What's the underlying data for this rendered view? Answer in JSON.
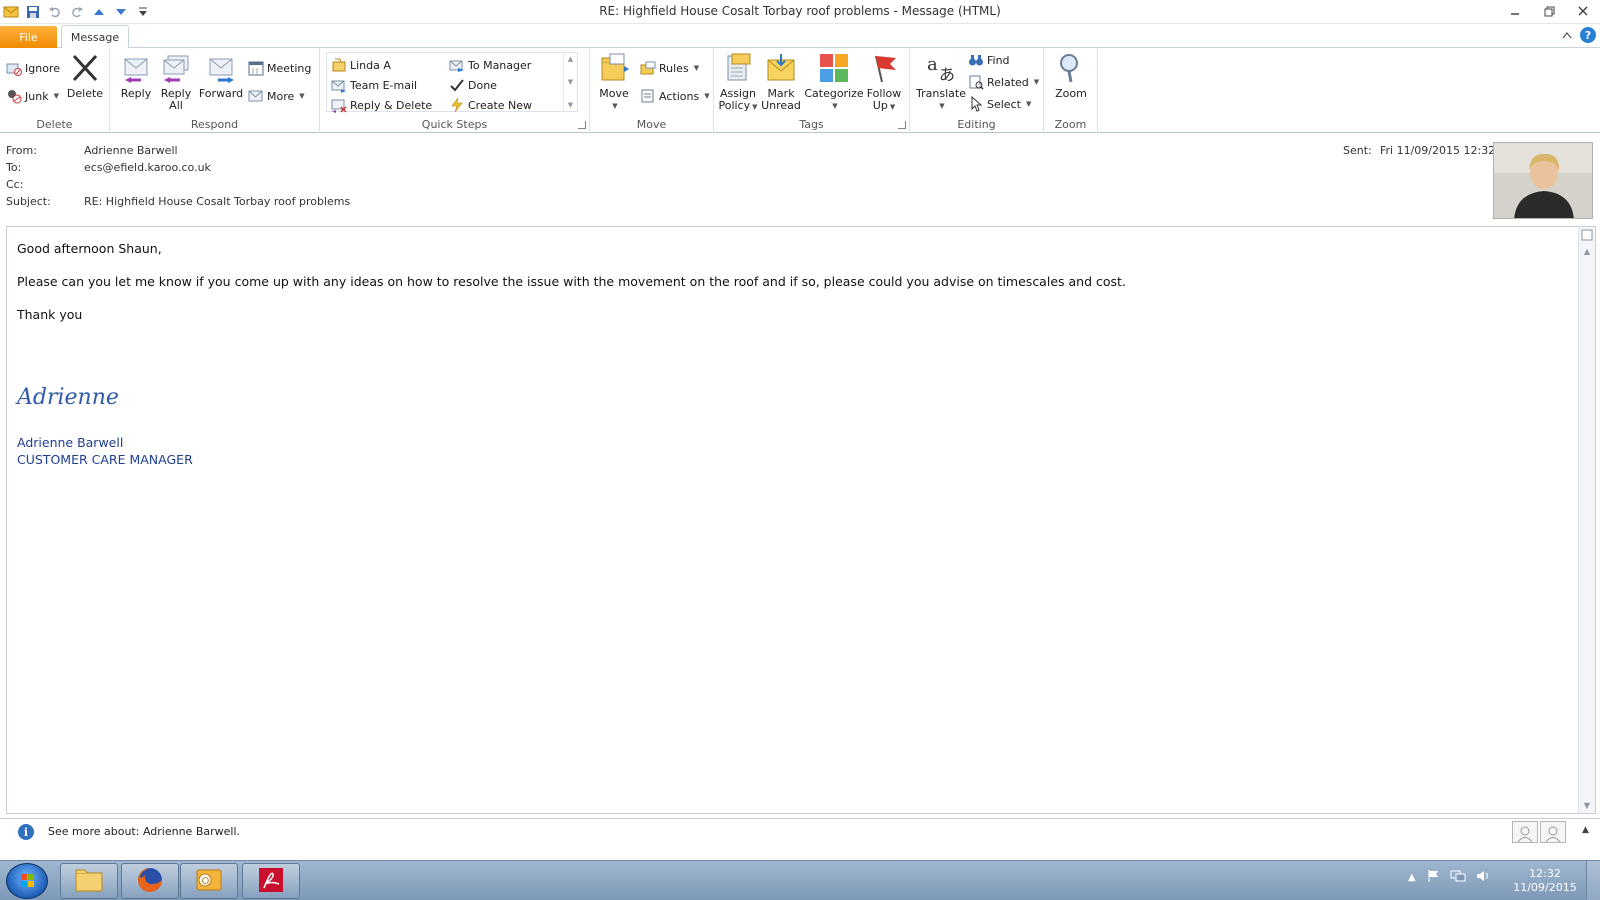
{
  "window": {
    "title": "RE: Highfield House Cosalt Torbay roof problems  -  Message (HTML)"
  },
  "tabs": {
    "file": "File",
    "message": "Message"
  },
  "ribbon": {
    "delete_group": {
      "label": "Delete",
      "ignore": "Ignore",
      "junk": "Junk",
      "delete": "Delete"
    },
    "respond_group": {
      "label": "Respond",
      "reply": "Reply",
      "reply_all_1": "Reply",
      "reply_all_2": "All",
      "forward": "Forward",
      "meeting": "Meeting",
      "more": "More"
    },
    "quick_steps_group": {
      "label": "Quick Steps",
      "items": [
        "Linda A",
        "Team E-mail",
        "Reply & Delete",
        "To Manager",
        "Done",
        "Create New"
      ]
    },
    "move_group": {
      "label": "Move",
      "move": "Move",
      "rules": "Rules",
      "actions": "Actions"
    },
    "tags_group": {
      "label": "Tags",
      "assign_1": "Assign",
      "assign_2": "Policy",
      "mark_1": "Mark",
      "mark_2": "Unread",
      "categorize": "Categorize",
      "follow_1": "Follow",
      "follow_2": "Up"
    },
    "editing_group": {
      "label": "Editing",
      "translate": "Translate",
      "find": "Find",
      "related": "Related",
      "select": "Select"
    },
    "zoom_group": {
      "label": "Zoom",
      "zoom": "Zoom"
    }
  },
  "header": {
    "from_label": "From:",
    "from_value": "Adrienne Barwell",
    "to_label": "To:",
    "to_value": "ecs@efield.karoo.co.uk",
    "cc_label": "Cc:",
    "cc_value": "",
    "subject_label": "Subject:",
    "subject_value": "RE: Highfield House Cosalt Torbay roof problems",
    "sent_label": "Sent:",
    "sent_value": "Fri 11/09/2015 12:32"
  },
  "body": {
    "greeting": "Good afternoon Shaun,",
    "paragraph": "Please can you let me know if you come up with any ideas on how to resolve the issue with the movement on the roof and if so, please could you advise on timescales and cost.",
    "closing": "Thank you",
    "signature_script": "Adrienne",
    "signature_name": "Adrienne Barwell",
    "signature_title": "CUSTOMER CARE MANAGER"
  },
  "people_pane": {
    "text": "See more about: Adrienne Barwell."
  },
  "taskbar": {
    "time": "12:32",
    "date": "11/09/2015"
  },
  "colors": {
    "file_tab": "#f08a00",
    "signature_blue": "#1f3f8f",
    "taskbar": "#8ea8c5"
  }
}
